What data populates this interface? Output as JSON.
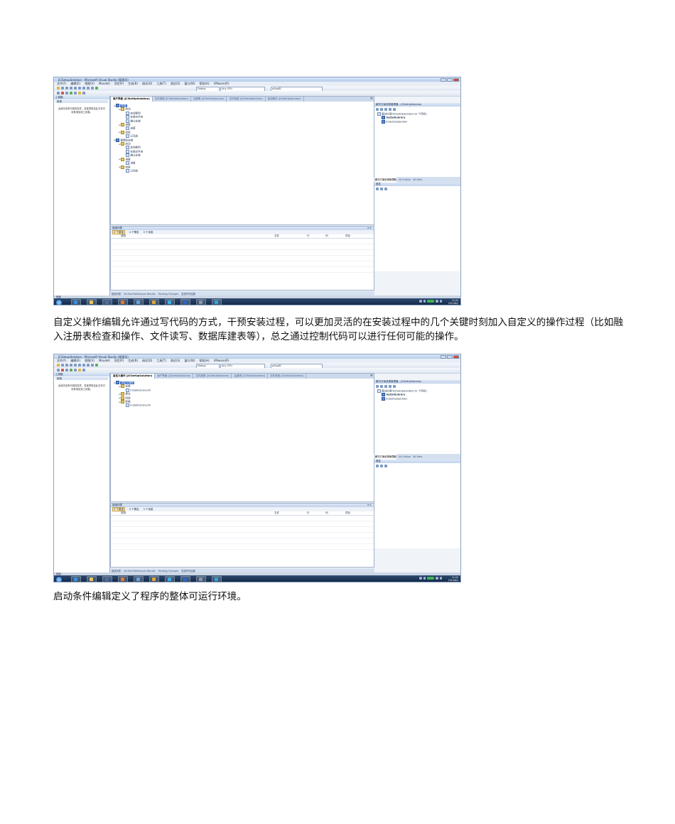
{
  "screenshots": [
    {
      "window_title": "JCiSetupSolution - Microsoft Visual Studio (管理员)",
      "menu": [
        "文件(F)",
        "编辑(E)",
        "视图(V)",
        "Moudell",
        "项目(P)",
        "生成(B)",
        "调试(D)",
        "工具(T)",
        "测试(S)",
        "窗口(W)",
        "帮助(H)",
        "VMware(R)"
      ],
      "toolbar": {
        "config": "Debug",
        "platform": "Any CPU",
        "target": "pSeqID"
      },
      "toolbox": {
        "title": "工具箱",
        "group": "常规",
        "hint": "此组中没有可用的控件。将某项拖至此文本可将其添加到工具箱。"
      },
      "tabs": [
        "用户界面 (JCiSetUpSolution)",
        "文件类型 (JCiSetUpSolution)",
        "注册表 (JCiSetUpSolution)",
        "文件系统 (JCiSetUpSolution)",
        "启动条件 (JCiSetUpSolution)"
      ],
      "tree": [
        {
          "text": "安装",
          "level": 0,
          "kind": "proj",
          "selected": true
        },
        {
          "text": "启动",
          "level": 1,
          "kind": "folder"
        },
        {
          "text": "欢迎使用",
          "level": 2,
          "kind": "file"
        },
        {
          "text": "安装文件夹",
          "level": 2,
          "kind": "file"
        },
        {
          "text": "确认安装",
          "level": 2,
          "kind": "file"
        },
        {
          "text": "进度",
          "level": 1,
          "kind": "folder"
        },
        {
          "text": "进度",
          "level": 2,
          "kind": "file"
        },
        {
          "text": "结束",
          "level": 1,
          "kind": "folder"
        },
        {
          "text": "已完成",
          "level": 2,
          "kind": "file"
        },
        {
          "text": "管理员安装",
          "level": 0,
          "kind": "proj"
        },
        {
          "text": "启动",
          "level": 1,
          "kind": "folder"
        },
        {
          "text": "欢迎使用",
          "level": 2,
          "kind": "file"
        },
        {
          "text": "安装文件夹",
          "level": 2,
          "kind": "file"
        },
        {
          "text": "确认安装",
          "level": 2,
          "kind": "file"
        },
        {
          "text": "进度",
          "level": 1,
          "kind": "folder"
        },
        {
          "text": "进度",
          "level": 2,
          "kind": "file"
        },
        {
          "text": "结束",
          "level": 1,
          "kind": "folder"
        },
        {
          "text": "已完成",
          "level": 2,
          "kind": "file"
        }
      ],
      "errors": {
        "title": "错误列表",
        "filters": [
          "0 个错误",
          "0 个警告",
          "0 个消息"
        ],
        "columns": [
          "说明",
          "文件",
          "行",
          "列",
          "项目"
        ]
      },
      "bottom_tabs": [
        "错误列表",
        "VA Find References Results",
        "Pending Changes",
        "查找符号结果"
      ],
      "solution": {
        "title": "解决方案资源管理器 - JCiSetUpSolution",
        "items": [
          "解决方案'JCiSetUpSolution'(2 个项目)",
          "InstallLibrary",
          "JCiSetUpSolution"
        ]
      },
      "right_tabs": [
        "解决方案资源管理器",
        "VA Outline",
        "VA View"
      ],
      "properties": {
        "title": "属性"
      },
      "status": "就绪",
      "clock": {
        "time": "11:22",
        "date": "2014/8/4"
      }
    },
    {
      "window_title": "JCiSetupSolution - Microsoft Visual Studio (管理员)",
      "menu": [
        "文件(F)",
        "编辑(E)",
        "视图(V)",
        "Moudell",
        "项目(P)",
        "生成(B)",
        "调试(D)",
        "工具(T)",
        "测试(S)",
        "窗口(W)",
        "帮助(H)",
        "VMware(R)"
      ],
      "toolbar": {
        "config": "Debug",
        "platform": "Any CPU",
        "target": "pSeqID"
      },
      "toolbox": {
        "title": "工具箱",
        "group": "常规",
        "hint": "此组中没有可用的控件。将某项拖至此文本可将其添加到工具箱。"
      },
      "tabs": [
        "自定义操作 (JCiSetUpSolution)",
        "用户界面 (JCiSetUpSolution)",
        "文件类型 (JCiSetUpSolution)",
        "注册表 (JCiSetUpSolution)",
        "文件系统 (JCiSetUpSolution)"
      ],
      "tree": [
        {
          "text": "自定义操作",
          "level": 0,
          "kind": "proj",
          "selected": true
        },
        {
          "text": "安装",
          "level": 1,
          "kind": "folder"
        },
        {
          "text": "InstallLibrary.dll",
          "level": 2,
          "kind": "file"
        },
        {
          "text": "提交",
          "level": 1,
          "kind": "folder"
        },
        {
          "text": "回滚",
          "level": 1,
          "kind": "folder"
        },
        {
          "text": "卸载",
          "level": 1,
          "kind": "folder"
        },
        {
          "text": "InstallLibrary.dll",
          "level": 2,
          "kind": "file"
        }
      ],
      "errors": {
        "title": "错误列表",
        "filters": [
          "0 个错误",
          "0 个警告",
          "0 个消息"
        ],
        "columns": [
          "说明",
          "文件",
          "行",
          "列",
          "项目"
        ]
      },
      "bottom_tabs": [
        "错误列表",
        "VA Find References Results",
        "Pending Changes",
        "查找符号结果"
      ],
      "solution": {
        "title": "解决方案资源管理器 - JCiSetUpSolution",
        "items": [
          "解决方案'JCiSetUpSolution'(2 个项目)",
          "InstallLibrary",
          "JCiSetUpSolution"
        ]
      },
      "right_tabs": [
        "解决方案资源管理器",
        "VA Outline",
        "VA View"
      ],
      "properties": {
        "title": "属性"
      },
      "status": "就绪",
      "clock": {
        "time": "11:22",
        "date": "2014/8/4"
      }
    }
  ],
  "captions": [
    "自定义操作编辑允许通过写代码的方式，干预安装过程，可以更加灵活的在安装过程中的几个关键时刻加入自定义的操作过程（比如融入注册表检查和操作、文件读写、数据库建表等），总之通过控制代码可以进行任何可能的操作。",
    "启动条件编辑定义了程序的整体可运行环境。"
  ]
}
